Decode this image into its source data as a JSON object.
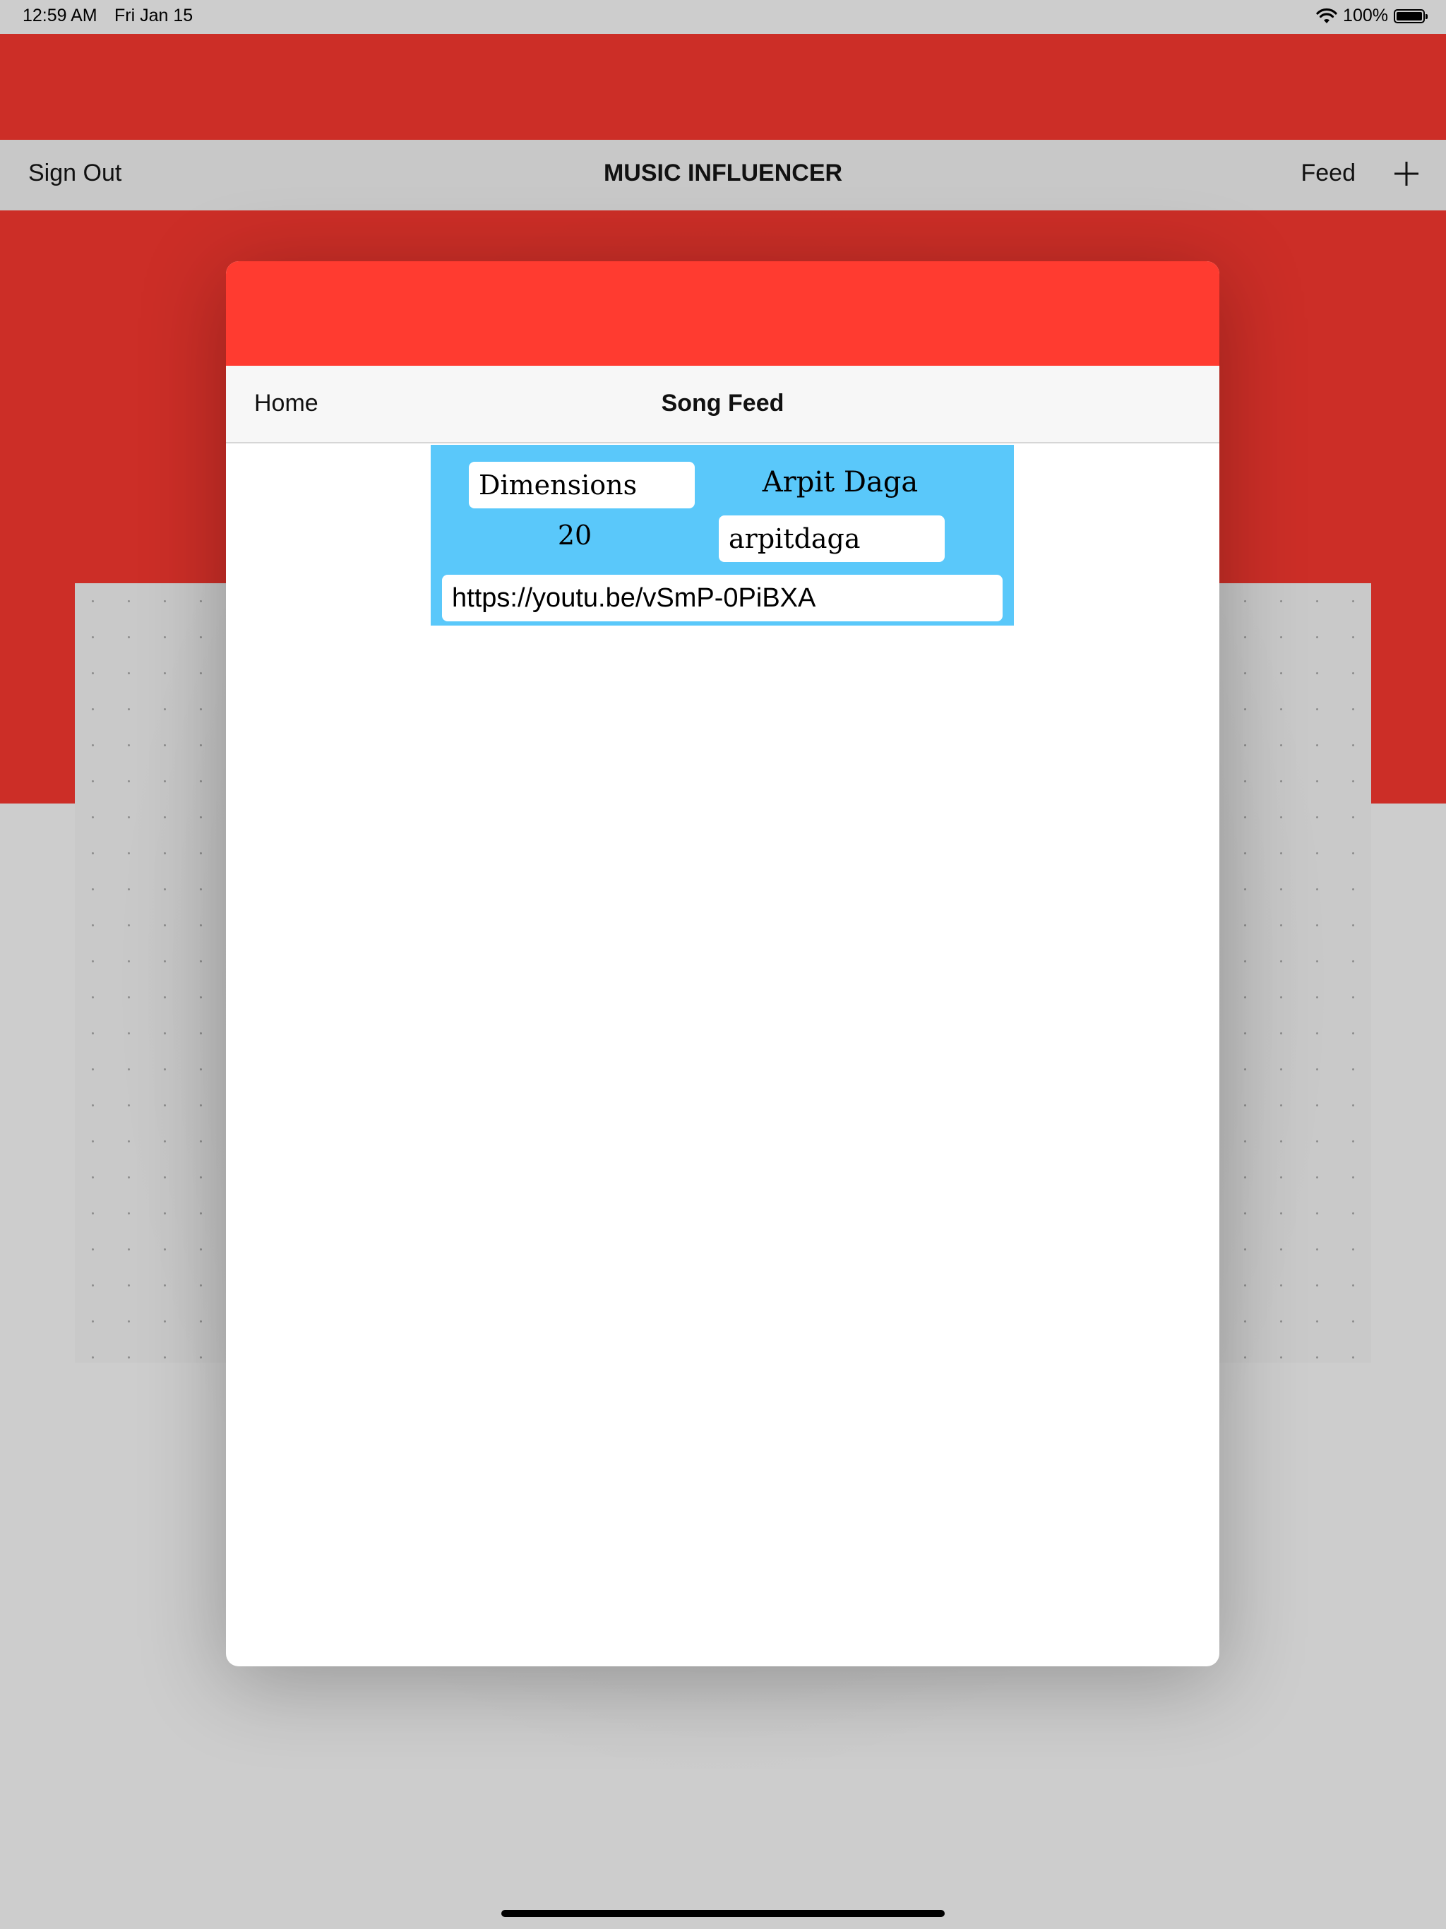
{
  "status_bar": {
    "time": "12:59 AM",
    "date": "Fri Jan 15",
    "battery": "100%",
    "battery_level": 1.0,
    "icons": [
      "wifi-icon",
      "battery-icon"
    ]
  },
  "app_nav": {
    "sign_out_label": "Sign Out",
    "title": "MUSIC INFLUENCER",
    "feed_label": "Feed",
    "add_icon": "plus-icon"
  },
  "sheet": {
    "home_label": "Home",
    "title": "Song Feed"
  },
  "song": {
    "name": "Dimensions",
    "artist": "Arpit Daga",
    "count": "20",
    "handle": "arpitdaga",
    "link": "https://youtu.be/vSmP-0PiBXA"
  },
  "colors": {
    "brand_red": "#cc2e27",
    "sheet_red": "#ff3b30",
    "cell_blue": "#5ac8fa"
  }
}
